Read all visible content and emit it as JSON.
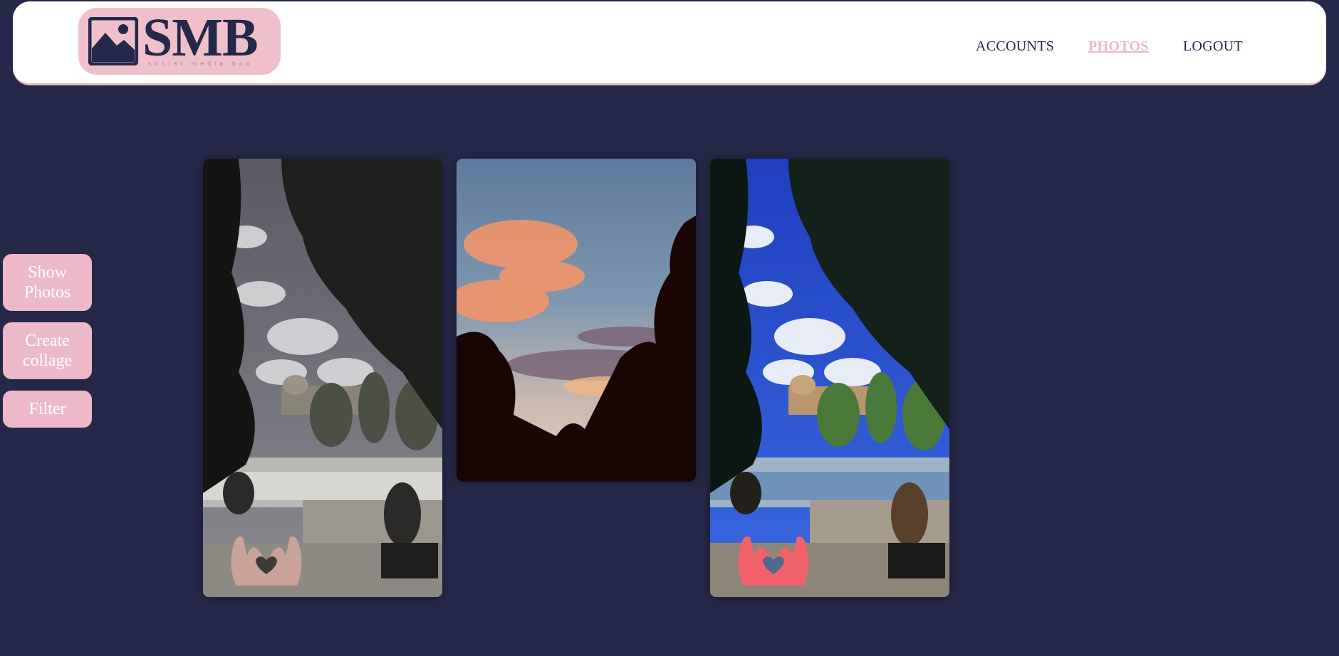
{
  "header": {
    "logo": {
      "text": "SMB",
      "tagline": "social media box",
      "icon": "image-icon"
    },
    "nav": [
      {
        "label": "ACCOUNTS",
        "active": false
      },
      {
        "label": "PHOTOS",
        "active": true
      },
      {
        "label": "LOGOUT",
        "active": false
      }
    ]
  },
  "sidebar": {
    "buttons": [
      {
        "label": "Show Photos"
      },
      {
        "label": "Create collage"
      },
      {
        "label": "Filter"
      }
    ]
  },
  "gallery": {
    "photos": [
      {
        "subject": "park fountain with trees",
        "filter": "sepia-desaturated",
        "sticker": "heart-hands-icon"
      },
      {
        "subject": "sunset sky with tree silhouettes",
        "filter": "none"
      },
      {
        "subject": "park fountain with trees",
        "filter": "vivid-blue",
        "sticker": "heart-hands-icon"
      }
    ]
  },
  "colors": {
    "background": "#252848",
    "accent_pink": "#efb8c8",
    "navy": "#24284a",
    "sticker_muted": "#c9a398",
    "sticker_vivid": "#f0636a"
  }
}
